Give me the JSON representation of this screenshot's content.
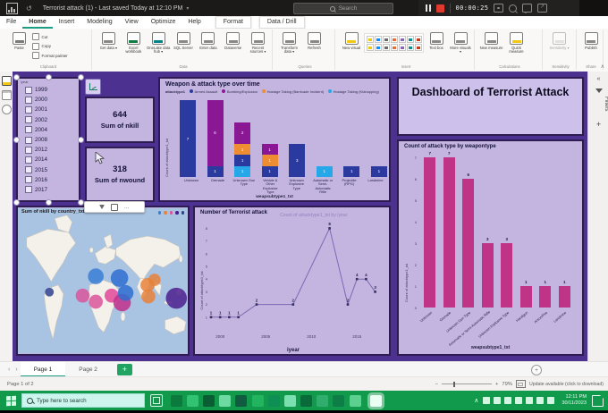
{
  "app": {
    "titlebar": {
      "title": "Terrorist attack (1) - Last saved Today at 12:10 PM",
      "search_placeholder": "Search",
      "recorder_time": "00:00:25"
    },
    "menu": {
      "tabs": [
        "File",
        "Home",
        "Insert",
        "Modeling",
        "View",
        "Optimize",
        "Help"
      ],
      "active_tab": "Home",
      "contextual_tabs": [
        "Format",
        "Data / Drill"
      ]
    },
    "ribbon": {
      "groups": [
        {
          "label": "Clipboard",
          "items": [
            {
              "label": "Paste",
              "icon": "paste-icon",
              "accent": "#7a7a78"
            },
            {
              "label": "Cut",
              "icon": "cut-icon"
            },
            {
              "label": "Copy",
              "icon": "copy-icon"
            },
            {
              "label": "Format painter",
              "icon": "format-painter-icon"
            }
          ]
        },
        {
          "label": "Data",
          "items": [
            {
              "label": "Get data",
              "icon": "get-data-icon",
              "accent": "#8a8886",
              "dropdown": true
            },
            {
              "label": "Excel workbook",
              "icon": "excel-workbook-icon",
              "accent": "#107c41"
            },
            {
              "label": "OneLake data hub",
              "icon": "onelake-data-hub-icon",
              "accent": "#038387",
              "dropdown": true
            },
            {
              "label": "SQL Server",
              "icon": "sql-server-icon",
              "accent": "#8a8886"
            },
            {
              "label": "Enter data",
              "icon": "enter-data-icon",
              "accent": "#8a8886"
            },
            {
              "label": "Dataverse",
              "icon": "dataverse-icon",
              "accent": "#8a8886"
            },
            {
              "label": "Recent sources",
              "icon": "recent-sources-icon",
              "accent": "#8a8886",
              "dropdown": true
            }
          ]
        },
        {
          "label": "Queries",
          "items": [
            {
              "label": "Transform data",
              "icon": "transform-data-icon",
              "accent": "#8a8886",
              "dropdown": true
            },
            {
              "label": "Refresh",
              "icon": "refresh-icon",
              "accent": "#8a8886"
            }
          ]
        },
        {
          "label": "Insert",
          "items": [
            {
              "label": "New visual",
              "icon": "new-visual-icon",
              "accent": "#f2c811"
            },
            {
              "label": "Text box",
              "icon": "text-box-icon",
              "accent": "#8a8886"
            },
            {
              "label": "More visuals",
              "icon": "more-visuals-icon",
              "accent": "#8a8886",
              "dropdown": true
            }
          ]
        },
        {
          "label": "Calculations",
          "items": [
            {
              "label": "New measure",
              "icon": "new-measure-icon",
              "accent": "#8a8886"
            },
            {
              "label": "Quick measure",
              "icon": "quick-measure-icon",
              "accent": "#f2c811"
            }
          ]
        },
        {
          "label": "Sensitivity",
          "items": [
            {
              "label": "Sensitivity",
              "icon": "sensitivity-icon",
              "accent": "#c8c6c4",
              "disabled": true,
              "dropdown": true
            }
          ]
        },
        {
          "label": "Share",
          "items": [
            {
              "label": "Publish",
              "icon": "publish-icon",
              "accent": "#8a8886"
            }
          ]
        }
      ]
    }
  },
  "report": {
    "dashboard_title": "Dashboard of Terrorist Attack",
    "filters_pane_label": "Filters",
    "slicer": {
      "field": "iyear",
      "years": [
        "1999",
        "2000",
        "2001",
        "2002",
        "2004",
        "2008",
        "2012",
        "2014",
        "2015",
        "2016",
        "2017"
      ]
    },
    "cards": [
      {
        "value": "644",
        "label": "Sum of nkill"
      },
      {
        "value": "318",
        "label": "Sum of nwound"
      }
    ]
  },
  "chart_data": [
    {
      "id": "weapon-attack-stacked",
      "type": "bar",
      "stacked": true,
      "title": "Weapon & attack type over time",
      "legend_label": "attacktype1",
      "legend_position": "top",
      "categories": [
        "Unknown",
        "Grenade",
        "Unknown Gun Type",
        "Vehicle & Other Explosive Type",
        "Unknown Explosive Type",
        "Automatic or Semi-Automatic Rifle",
        "Projectile (RPG)",
        "Landmine"
      ],
      "series": [
        {
          "name": "Armed Assault",
          "color": "#2b3a9e",
          "values": [
            7,
            1,
            1,
            1,
            3,
            0,
            1,
            1
          ]
        },
        {
          "name": "Bombing/Explosion",
          "color": "#8a1793",
          "values": [
            0,
            6,
            2,
            1,
            0,
            0,
            0,
            0
          ]
        },
        {
          "name": "Hostage Taking (Barricade Incident)",
          "color": "#ef8d33",
          "values": [
            0,
            0,
            1,
            1,
            0,
            0,
            0,
            0
          ]
        },
        {
          "name": "Hostage Taking (Kidnapping)",
          "color": "#26a7e8",
          "values": [
            0,
            0,
            1,
            0,
            0,
            1,
            0,
            0
          ]
        }
      ],
      "stacks": [
        [
          {
            "s": 0,
            "v": 7
          }
        ],
        [
          {
            "s": 0,
            "v": 1
          },
          {
            "s": 1,
            "v": 6
          }
        ],
        [
          {
            "s": 3,
            "v": 1
          },
          {
            "s": 0,
            "v": 1
          },
          {
            "s": 2,
            "v": 1
          },
          {
            "s": 1,
            "v": 2
          }
        ],
        [
          {
            "s": 0,
            "v": 1
          },
          {
            "s": 2,
            "v": 1
          },
          {
            "s": 1,
            "v": 1
          }
        ],
        [
          {
            "s": 0,
            "v": 3
          }
        ],
        [
          {
            "s": 3,
            "v": 1
          }
        ],
        [
          {
            "s": 0,
            "v": 1
          }
        ],
        [
          {
            "s": 0,
            "v": 1
          }
        ]
      ],
      "xlabel": "weapsubtype1_txt",
      "ylabel": "Count of attacktype1_txt",
      "ylim": [
        0,
        7
      ]
    },
    {
      "id": "attack-map",
      "type": "map",
      "title": "Sum of nkill by country_txt",
      "legend_colors": [
        "#3a7fd5",
        "#e8833a",
        "#d9569b",
        "#4b1f8e",
        "#2f3f8f"
      ],
      "bubbles": [
        {
          "x": 36,
          "y": 96,
          "r": 5,
          "color": "#2f3f8f"
        },
        {
          "x": 74,
          "y": 100,
          "r": 8,
          "color": "#d9569b"
        },
        {
          "x": 89,
          "y": 107,
          "r": 8,
          "color": "#d9569b"
        },
        {
          "x": 107,
          "y": 100,
          "r": 8,
          "color": "#e0489a"
        },
        {
          "x": 119,
          "y": 108,
          "r": 10,
          "color": "#c2308c"
        },
        {
          "x": 89,
          "y": 78,
          "r": 9,
          "color": "#3a7fd5"
        },
        {
          "x": 116,
          "y": 80,
          "r": 10,
          "color": "#2f6fd0"
        },
        {
          "x": 123,
          "y": 97,
          "r": 9,
          "color": "#2f6fd0"
        },
        {
          "x": 148,
          "y": 88,
          "r": 8,
          "color": "#e8833a"
        },
        {
          "x": 156,
          "y": 82,
          "r": 7,
          "color": "#e8833a"
        },
        {
          "x": 149,
          "y": 101,
          "r": 8,
          "color": "#e8833a"
        },
        {
          "x": 181,
          "y": 103,
          "r": 12,
          "color": "#4b1f8e"
        }
      ]
    },
    {
      "id": "attacks-over-time-line",
      "type": "line",
      "title": "Number of Terrorist attack",
      "ghost_title": "Count of attacktype1_txt by iyear",
      "x": [
        1999,
        2000,
        2001,
        2002,
        2004,
        2008,
        2012,
        2014,
        2015,
        2016,
        2017
      ],
      "y": [
        1,
        1,
        1,
        1,
        2,
        2,
        8,
        2,
        4,
        4,
        3
      ],
      "xticks": [
        2000,
        2005,
        2010,
        2015
      ],
      "yticks": [
        1,
        2,
        3,
        4,
        5,
        6,
        7,
        8
      ],
      "xlabel": "iyear",
      "ylabel": "Count of attacktype1_txt",
      "line_color": "#7a68b4"
    },
    {
      "id": "attack-type-by-weapon-bar",
      "type": "bar",
      "title": "Count of attack type by weapontype",
      "categories": [
        "Unknown",
        "Grenade",
        "Unknown Gun Type",
        "Automatic or Semi-Automatic Rifle",
        "Unknown Explosive Type",
        "Handgun",
        "Arson/Fire",
        "Landmine"
      ],
      "values": [
        7,
        7,
        6,
        3,
        3,
        1,
        1,
        1
      ],
      "bar_color": "#c03488",
      "yticks": [
        0,
        1,
        2,
        3,
        4,
        5,
        6,
        7
      ],
      "xlabel": "weapsubtype1_txt",
      "ylabel": "Count of attacktype1_txt",
      "ylim": [
        0,
        7
      ]
    }
  ],
  "footer": {
    "pages": [
      "Page 1",
      "Page 2"
    ],
    "active_page": "Page 1",
    "page_indicator": "Page 1 of 2",
    "zoom_level": "79%",
    "update_text": "Update available (click to download)"
  },
  "taskbar": {
    "search_placeholder": "Type here to search",
    "time": "12:11 PM",
    "date": "30/11/2023"
  }
}
